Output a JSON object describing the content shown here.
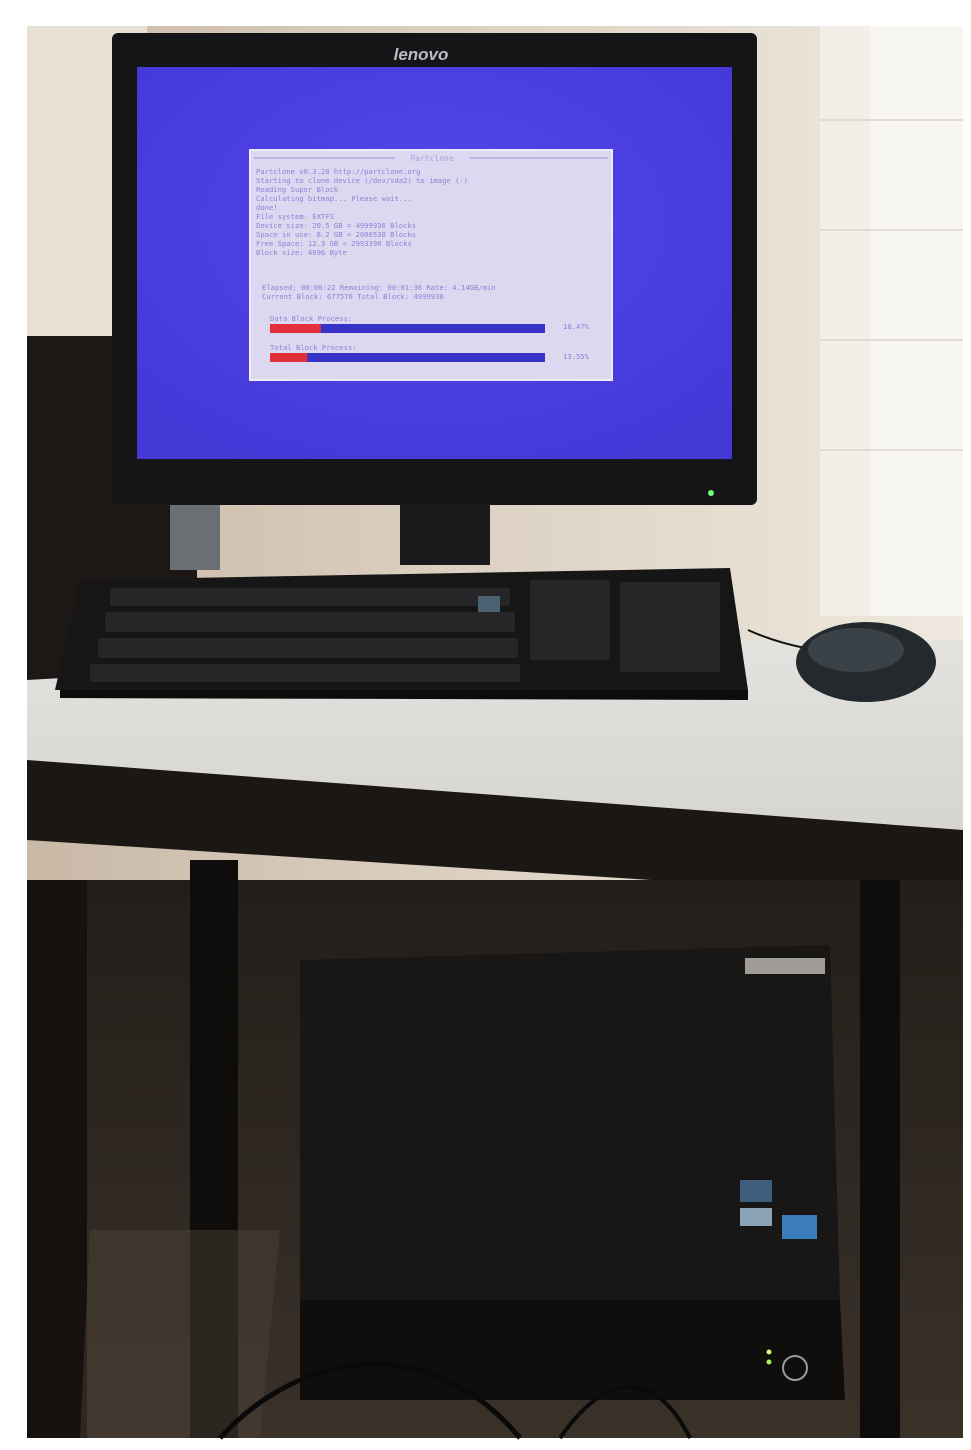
{
  "monitor": {
    "brand": "lenovo"
  },
  "partclone": {
    "title": "Partclone",
    "lines": [
      "Partclone v0.3.20 http://partclone.org",
      "Starting to clone device (/dev/sda2) to image (-)",
      "Reading Super Block",
      "Calculating bitmap... Please wait...",
      "done!",
      "File system:  EXTFS",
      "Device size:   20.5 GB = 4999936 Blocks",
      "Space in use:   8.2 GB = 2006538 Blocks",
      "Free Space:    12.3 GB = 2993398 Blocks",
      "Block size:   4096 Byte"
    ],
    "status_lines": [
      "Elapsed: 00:00:22 Remaining: 00:01:36   Rate:   4.14GB/min",
      "Current Block: 677576  Total Block: 4999936"
    ],
    "data_block": {
      "label": "Data Block Process:",
      "percent_text": "18.47%",
      "fraction": 0.1847
    },
    "total_block": {
      "label": "Total Block Process:",
      "percent_text": "13.55%",
      "fraction": 0.1355
    }
  },
  "colors": {
    "screen_blue": "#4b3fe4",
    "dialog_bg": "#dcd8f0",
    "progress_blue": "#3732c8",
    "progress_red": "#e0303a"
  }
}
